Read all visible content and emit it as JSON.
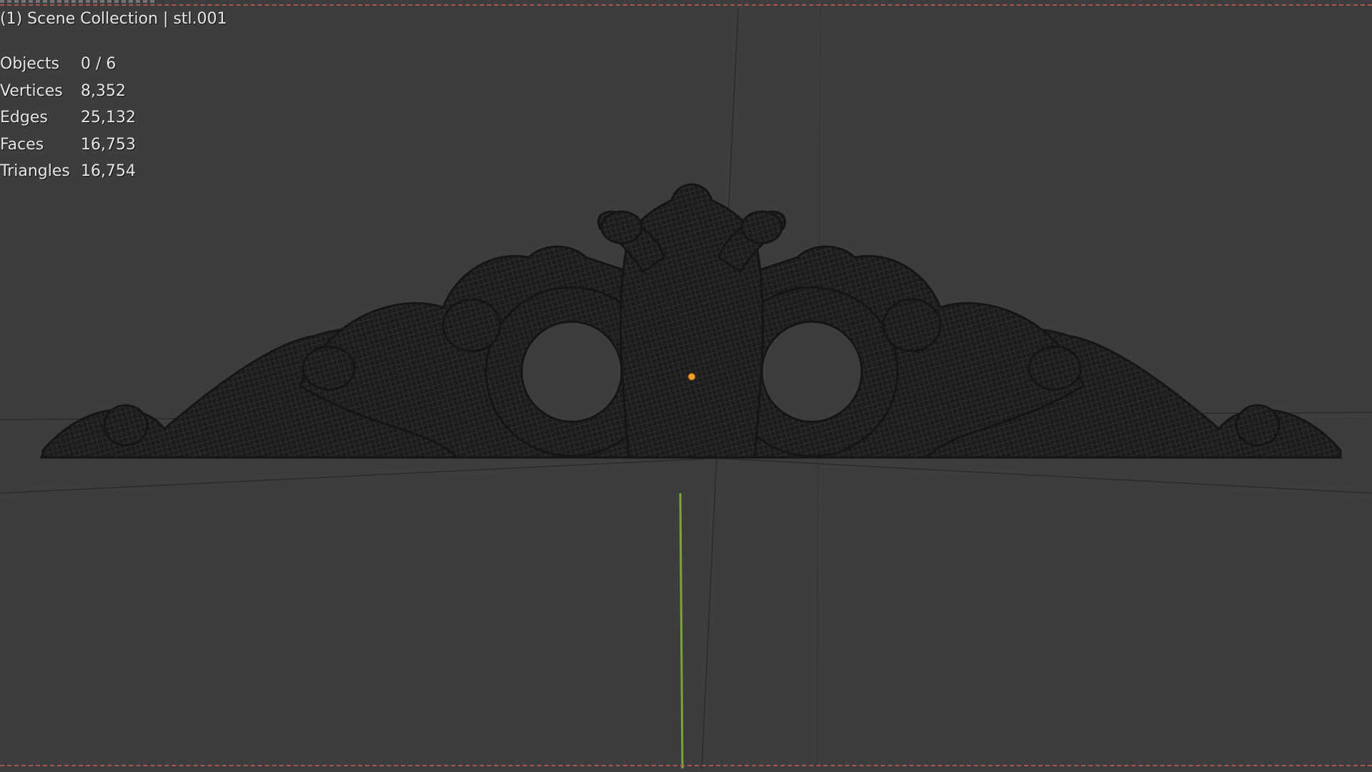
{
  "viewport": {
    "title": "(1) Scene Collection | stl.001",
    "stats": [
      {
        "label": "Objects",
        "value": "0 / 6"
      },
      {
        "label": "Vertices",
        "value": "8,352"
      },
      {
        "label": "Edges",
        "value": "25,132"
      },
      {
        "label": "Faces",
        "value": "16,753"
      },
      {
        "label": "Triangles",
        "value": "16,754"
      }
    ],
    "colors": {
      "background": "#3d3d3d",
      "mesh": "#1a1a1a",
      "origin_dot": "#f0a030",
      "y_axis": "#7fa33a",
      "region_border": "#c85a5a"
    },
    "icons": {
      "origin": "object-origin-icon"
    }
  }
}
